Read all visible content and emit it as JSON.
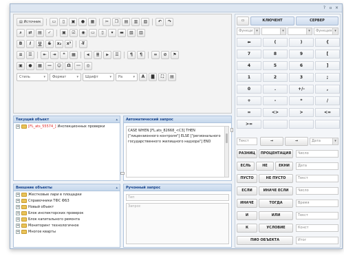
{
  "toolbar": {
    "row1": {
      "source_label": "Источник"
    },
    "row5": {
      "styles": "Стиль",
      "format": "Формат",
      "font": "Шрифт",
      "size": "Ра"
    }
  },
  "panels": {
    "current_object": {
      "title": "Текущий объект",
      "tree": [
        {
          "code": "[FL_ats_55574_]",
          "label": "Инспекционных проверки"
        }
      ]
    },
    "auto_request": {
      "title": "Автоматический запрос",
      "text": "CASE WHEN [FL.ats_82668_<C3] THEN [\"лицензионного контроля\"] ELSE [\"регионального государственного жилищного надзора\"] END"
    },
    "other_objects": {
      "title": "Внешние объекты",
      "items": [
        "Жестковые лари в площадки",
        "Справочники ТФС ФБ3",
        "Новый объект",
        "Блок инспекторских проверок",
        "Блок капитального ремонта",
        "Мониторинг технологичное",
        "Многое кварты"
      ]
    },
    "manual_request": {
      "title": "Ручонный запрос",
      "field1_placeholder": "Тип",
      "field2_placeholder": "Запрос"
    }
  },
  "right": {
    "top_buttons": [
      "КЛЮЧЕНТ",
      "СЕРВЕР"
    ],
    "combo_labels": [
      "Функци",
      "",
      "",
      "Функция"
    ],
    "keypad": [
      [
        "⬅",
        "(",
        ")",
        "{"
      ],
      [
        "7",
        "8",
        "9",
        "["
      ],
      [
        "4",
        "5",
        "6",
        "]"
      ],
      [
        "1",
        "2",
        "3",
        ";"
      ],
      [
        "0",
        ".",
        "+/-",
        ","
      ],
      [
        "+",
        "-",
        "*",
        "/"
      ],
      [
        "=",
        "<>",
        ">",
        "<="
      ],
      [
        ">=",
        "",
        "",
        ""
      ]
    ],
    "arrows": [
      "Текст",
      "→",
      "→",
      "Дата"
    ],
    "ops": [
      {
        "a": "РАЗНИЦ",
        "b": "ПРОЦЕНТАЦИЯ",
        "c": "Число"
      },
      {
        "a": "ЕСЛЬ",
        "b": "НЕ",
        "c": "ЕКНИ",
        "d": "Дата"
      },
      {
        "a": "ПУСТО",
        "b": "НЕ ПУСТО",
        "c": "Текст"
      },
      {
        "a": "ЕСЛИ",
        "b": "ИНАЧЕ ЕСЛИ",
        "c": "Число"
      },
      {
        "a": "ИНАЧЕ",
        "b": "ТОГДА",
        "c": "Время"
      },
      {
        "a": "И",
        "b": "ИЛИ",
        "c": "Текст"
      },
      {
        "a": "К",
        "b": "УСЛОВИЕ",
        "c": "Конст"
      },
      {
        "a": "ПИО ОБЪЕКТА",
        "c": "Итог"
      }
    ]
  },
  "colors": {
    "panel_header": "#c5d7ec",
    "accent": "#15428b",
    "error_red": "#dd2222"
  }
}
